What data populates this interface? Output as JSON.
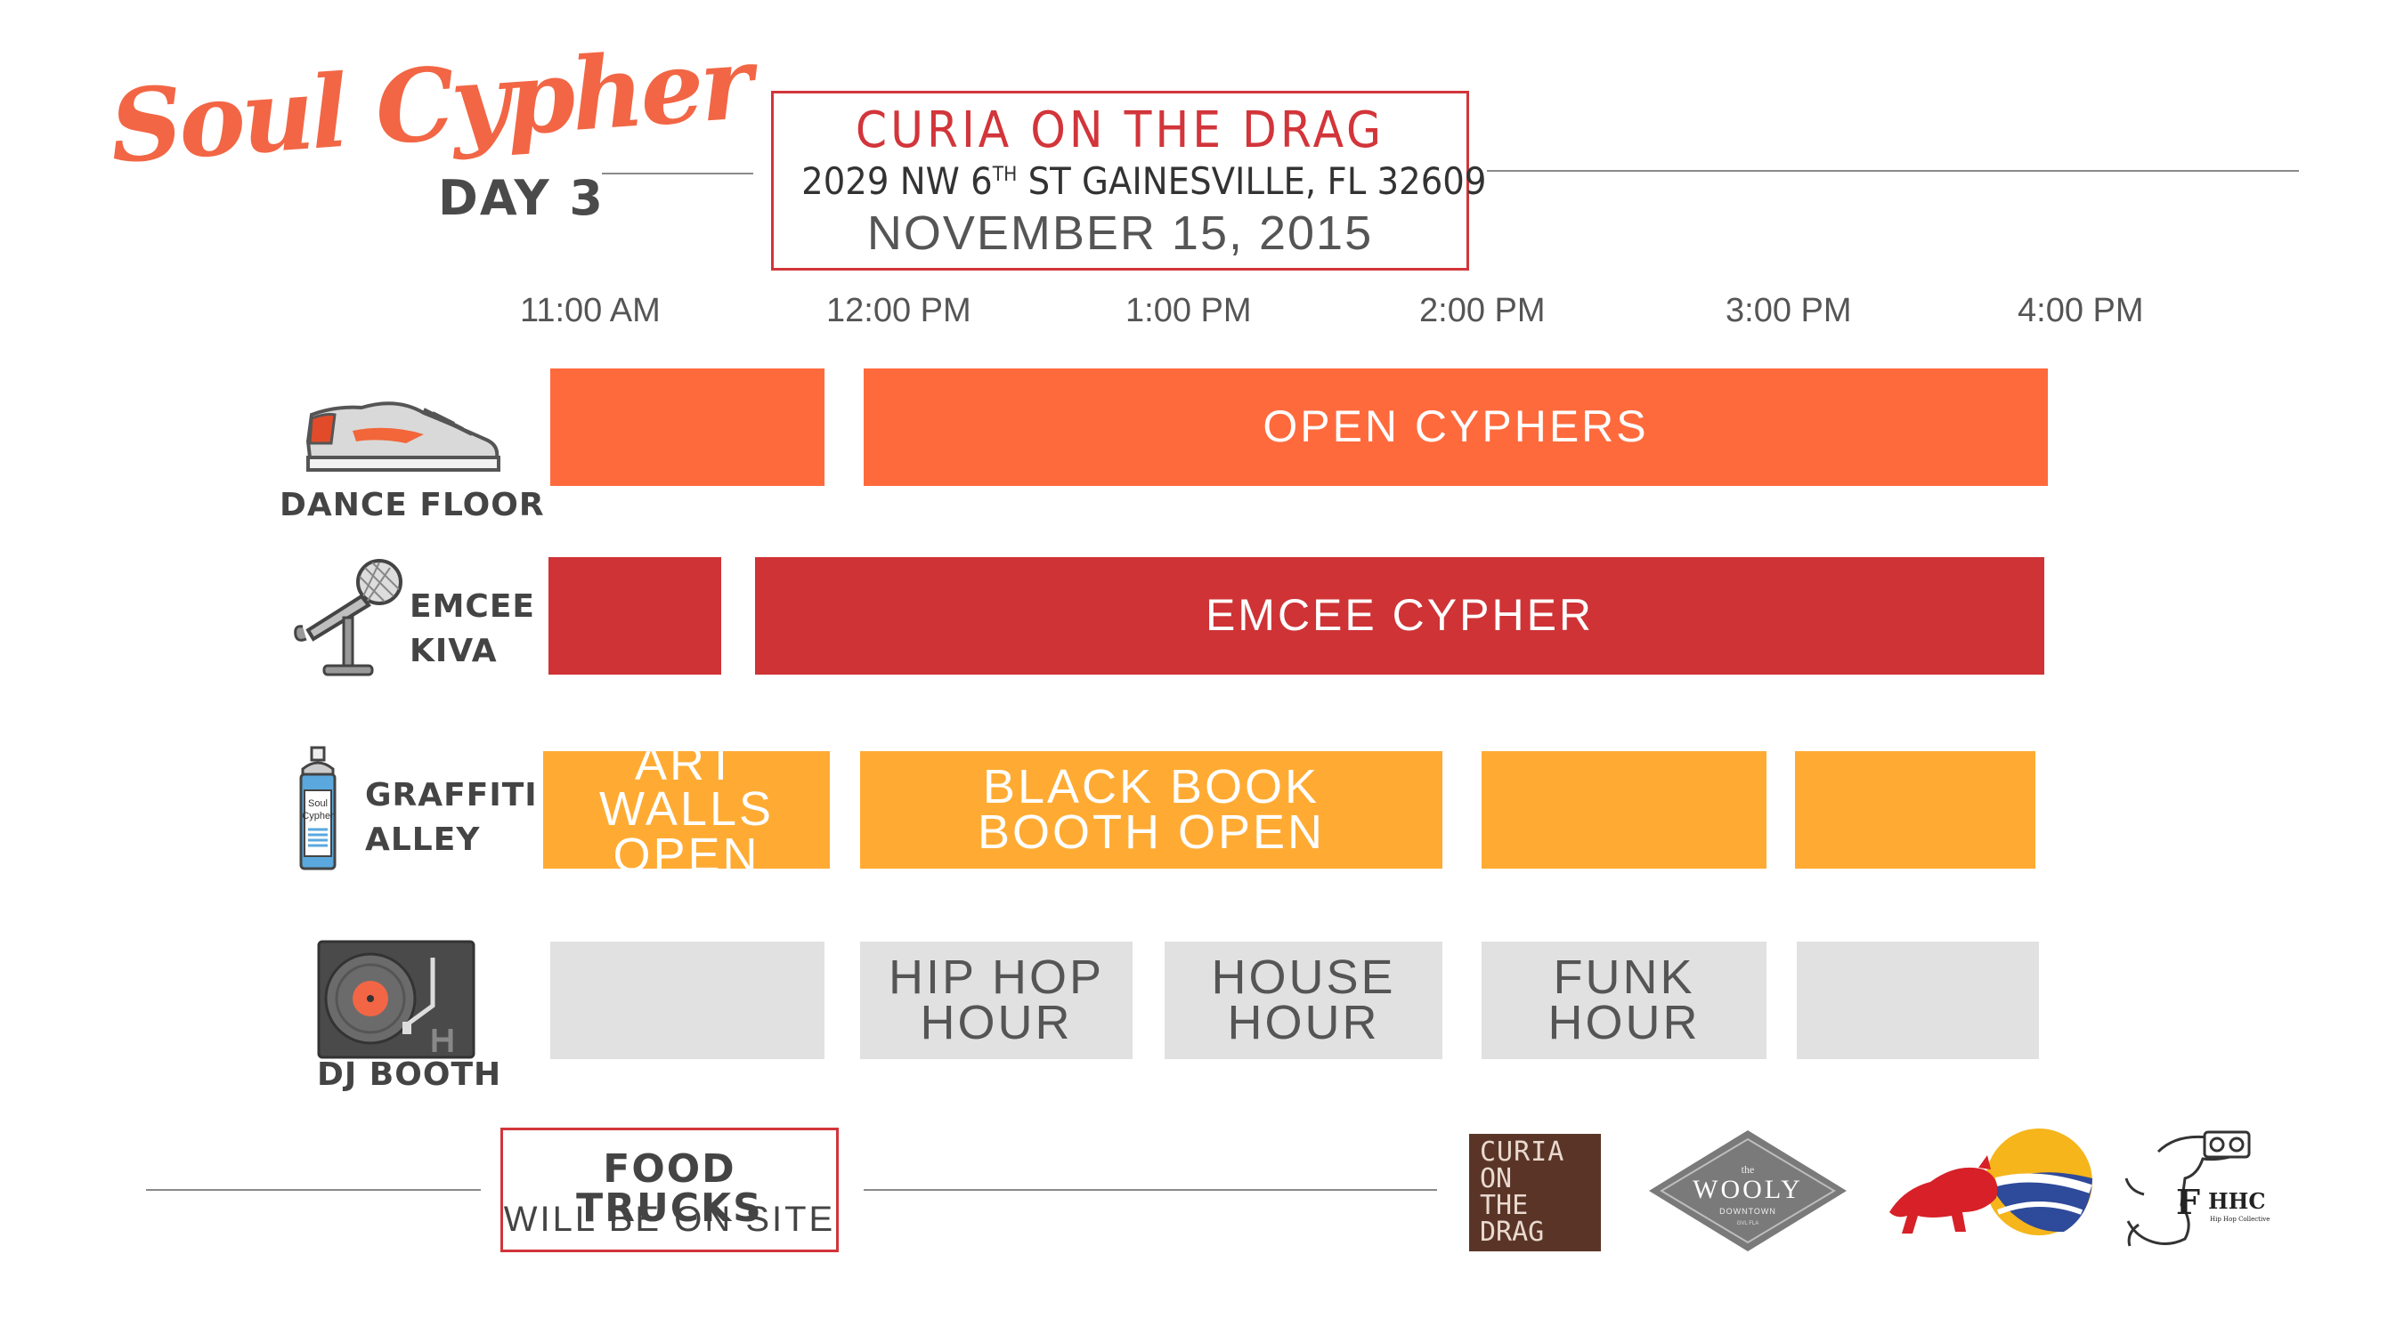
{
  "header": {
    "title_script": "Soul Cypher",
    "day": "DAY 3",
    "venue_name": "CURIA ON THE DRAG",
    "venue_address_num": "2029 NW 6",
    "venue_address_sup": "TH",
    "venue_address_rest": " ST GAINESVILLE, FL 32609",
    "venue_date": "NOVEMBER 15, 2015"
  },
  "times": [
    "11:00 AM",
    "12:00 PM",
    "1:00 PM",
    "2:00 PM",
    "3:00 PM",
    "4:00 PM"
  ],
  "rows": {
    "dance": {
      "label": "DANCE FLOOR",
      "icon": "sneaker-icon",
      "blocks": [
        "",
        "OPEN CYPHERS"
      ]
    },
    "emcee": {
      "label_1": "EMCEE",
      "label_2": "KIVA",
      "icon": "microphone-icon",
      "blocks": [
        "",
        "EMCEE CYPHER"
      ]
    },
    "graffiti": {
      "label_1": "GRAFFITI",
      "label_2": "ALLEY",
      "icon": "spray-can-icon",
      "can_text_1": "Soul",
      "can_text_2": "Cypher",
      "blocks": [
        {
          "line_1": "ART WALLS",
          "line_2": "OPEN"
        },
        {
          "line_1": "BLACK BOOK",
          "line_2": "BOOTH OPEN"
        },
        {
          "line_1": "",
          "line_2": ""
        },
        {
          "line_1": "",
          "line_2": ""
        }
      ]
    },
    "dj": {
      "label": "DJ BOOTH",
      "icon": "turntable-icon",
      "blocks": [
        {
          "line_1": "",
          "line_2": ""
        },
        {
          "line_1": "HIP HOP",
          "line_2": "HOUR"
        },
        {
          "line_1": "HOUSE",
          "line_2": "HOUR"
        },
        {
          "line_1": "FUNK",
          "line_2": "HOUR"
        },
        {
          "line_1": "",
          "line_2": ""
        }
      ]
    }
  },
  "footer": {
    "food_line_1": "FOOD TRUCKS",
    "food_line_2": "WILL BE ON SITE",
    "sponsors": {
      "curia": [
        "CURIA",
        "ON",
        "THE",
        "DRAG"
      ],
      "wooly": {
        "small": "the",
        "name": "WOOLY",
        "sub": "DOWNTOWN",
        "tiny": "GVL FLA"
      },
      "redbull_icon": "red-bull-logo",
      "hhc": {
        "letter": "F",
        "name": "HHC",
        "sub": "Hip Hop Collective"
      }
    }
  },
  "colors": {
    "accent_red": "#d2353a",
    "dance_orange": "#ff6a3d",
    "emcee_red": "#cf3336",
    "graffiti_yellow": "#ffab33",
    "dj_gray": "#e1e1e1",
    "script_orange": "#f26645"
  }
}
